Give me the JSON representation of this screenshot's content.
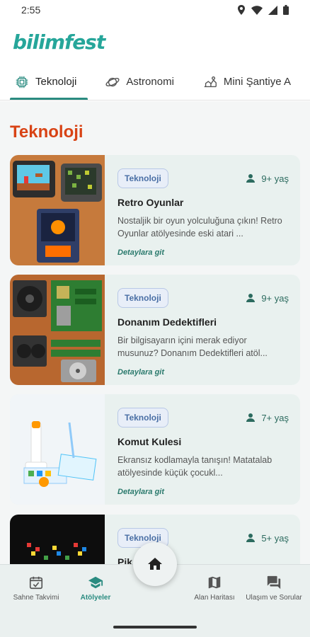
{
  "status": {
    "time": "2:55"
  },
  "app": {
    "logo": "bilimfest"
  },
  "tabs": [
    {
      "label": "Teknoloji",
      "icon": "chip-icon",
      "active": true
    },
    {
      "label": "Astronomi",
      "icon": "planet-icon",
      "active": false
    },
    {
      "label": "Mini Şantiye A",
      "icon": "construction-icon",
      "active": false
    }
  ],
  "section": {
    "title": "Teknoloji"
  },
  "cards": [
    {
      "tag": "Teknoloji",
      "age": "9+ yaş",
      "title": "Retro Oyunlar",
      "description": "Nostaljik bir oyun yolculuğuna çıkın! Retro Oyunlar atölyesinde eski atari ...",
      "link": "Detaylara git"
    },
    {
      "tag": "Teknoloji",
      "age": "9+ yaş",
      "title": "Donanım Dedektifleri",
      "description": "Bir bilgisayarın içini merak ediyor musunuz? Donanım Dedektifleri atöl...",
      "link": "Detaylara git"
    },
    {
      "tag": "Teknoloji",
      "age": "7+ yaş",
      "title": "Komut Kulesi",
      "description": "Ekransız kodlamayla tanışın! Matatalab atölyesinde küçük çocukl...",
      "link": "Detaylara git"
    },
    {
      "tag": "Teknoloji",
      "age": "5+ yaş",
      "title": "Pik",
      "description": "",
      "link": ""
    }
  ],
  "bottom_nav": [
    {
      "label": "Sahne Takvimi",
      "icon": "calendar-icon",
      "active": false
    },
    {
      "label": "Atölyeler",
      "icon": "graduation-cap-icon",
      "active": true
    },
    {
      "label": "Alan Haritası",
      "icon": "map-icon",
      "active": false
    },
    {
      "label": "Ulaşım ve Sorular",
      "icon": "chat-icon",
      "active": false
    }
  ],
  "colors": {
    "accent": "#2a8b80",
    "section_title": "#d84315",
    "card_bg": "#e9f1ef"
  }
}
